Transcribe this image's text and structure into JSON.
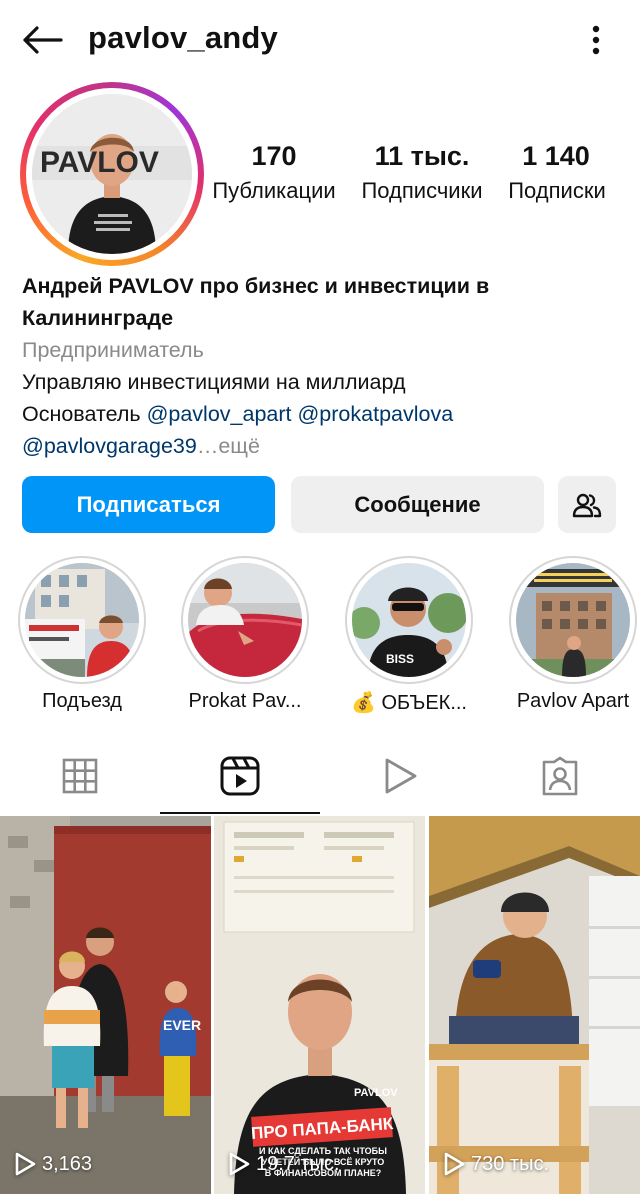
{
  "header": {
    "username": "pavlov_andy"
  },
  "profile": {
    "avatar_logo": "PAVLOV",
    "stats": [
      {
        "value": "170",
        "label": "Публикации"
      },
      {
        "value": "11 тыс.",
        "label": "Подписчики"
      },
      {
        "value": "1 140",
        "label": "Подписки"
      }
    ],
    "name_line1": "Андрей PAVLOV про бизнес и инвестиции в",
    "name_line2": "Калининграде",
    "category": "Предприниматель",
    "bio_line1": "Управляю инвестициями на миллиард",
    "bio_founder": "Основатель",
    "mention1": "@pavlov_apart",
    "mention2": "@prokatpavlova",
    "mention3": "@pavlovgarage39",
    "more_label": "…ещё"
  },
  "actions": {
    "follow": "Подписаться",
    "message": "Сообщение"
  },
  "highlights": [
    {
      "label": "Подъезд"
    },
    {
      "label": "Prokat Pav..."
    },
    {
      "label": "💰 ОБЪЕК..."
    },
    {
      "label": "Pavlov Apart"
    }
  ],
  "tabs": [
    "grid-icon",
    "reels-icon",
    "play-icon",
    "tagged-icon"
  ],
  "reels": [
    {
      "views": "3,163"
    },
    {
      "views": "19.7 тыс.",
      "overlay_title": "ПРО ПАПА-БАНК",
      "overlay_text": "И КАК СДЕЛАТЬ ТАК ЧТОБЫ У ДЕТЕЙ БЫЛО ВСЁ КРУТО В ФИНАНСОВОМ ПЛАНЕ?"
    },
    {
      "views": "730 тыс."
    }
  ],
  "colors": {
    "accent": "#0095f6",
    "link": "#00376b",
    "muted": "#8a8a8a",
    "button_bg": "#efefef"
  }
}
